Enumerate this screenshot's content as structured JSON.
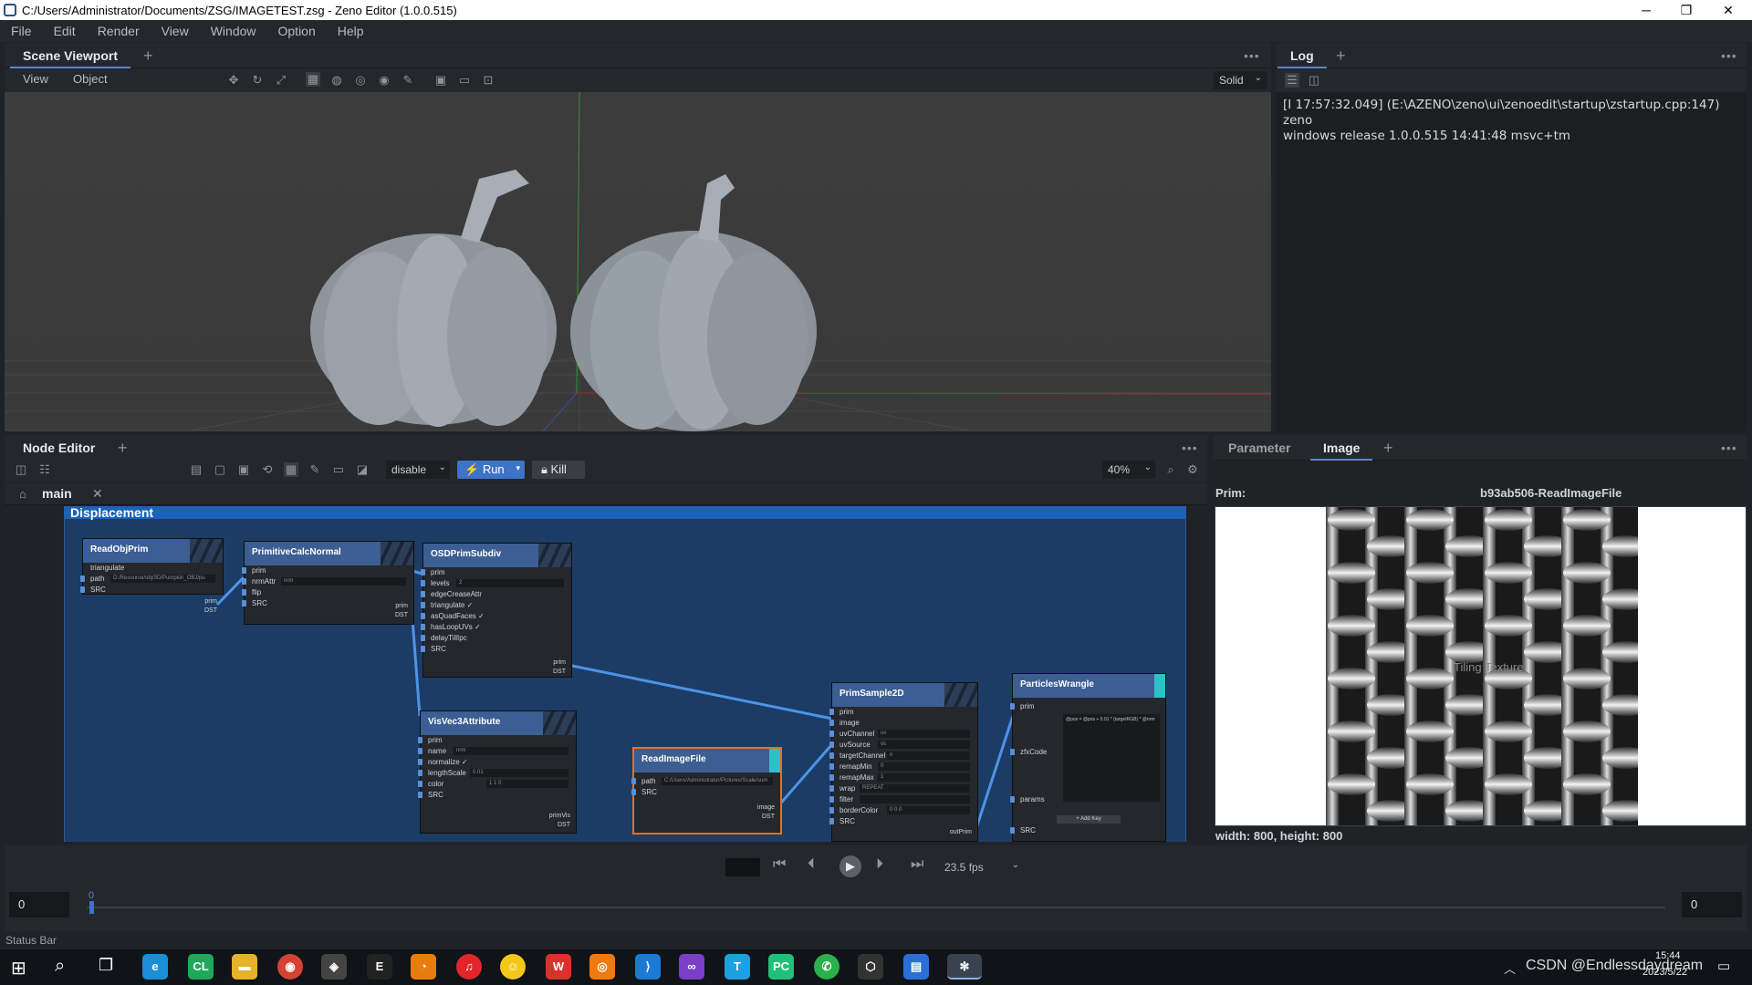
{
  "window": {
    "title": "C:/Users/Administrator/Documents/ZSG/IMAGETEST.zsg - Zeno Editor (1.0.0.515)"
  },
  "menu": [
    "File",
    "Edit",
    "Render",
    "View",
    "Window",
    "Option",
    "Help"
  ],
  "scene_viewport": {
    "tab": "Scene Viewport",
    "toolbar": [
      "View",
      "Object"
    ],
    "render_mode": "Solid"
  },
  "log": {
    "tab": "Log",
    "line1": "[I 17:57:32.049] (E:\\AZENO\\zeno\\ui\\zenoedit\\startup\\zstartup.cpp:147) zeno",
    "line2": "windows release 1.0.0.515 14:41:48 msvc+tm"
  },
  "node_editor": {
    "tab": "Node Editor",
    "mode": "disable",
    "run": "Run",
    "kill": "Kill",
    "zoom": "40%",
    "graph_tab": "main",
    "group_title": "Displacement",
    "nodes": {
      "readobj": {
        "title": "ReadObjPrim",
        "rows": [
          "triangulate",
          "path",
          "SRC"
        ],
        "path_val": "D:/Resource/obj/3D/Pumpkin_OBJ/pu",
        "outs": [
          "prim",
          "DST"
        ]
      },
      "calcnormal": {
        "title": "PrimitiveCalcNormal",
        "rows": [
          "prim",
          "nrmAttr",
          "flip",
          "SRC"
        ],
        "nrm_val": "nrm",
        "outs": [
          "prim",
          "DST"
        ]
      },
      "osd": {
        "title": "OSDPrimSubdiv",
        "rows": [
          "prim",
          "levels",
          "edgeCreaseAttr",
          "triangulate ✓",
          "asQuadFaces ✓",
          "hasLoopUVs ✓",
          "delayTillIpc",
          "SRC"
        ],
        "levels_val": "2",
        "outs": [
          "prim",
          "DST"
        ]
      },
      "visvec": {
        "title": "VisVec3Attribute",
        "rows": [
          "prim",
          "name",
          "normalize ✓",
          "lengthScale",
          "color",
          "SRC"
        ],
        "name_val": "nrm",
        "scale_val": "0.01",
        "color_val": "1       1       0",
        "outs": [
          "primVis",
          "DST"
        ]
      },
      "readimage": {
        "title": "ReadImageFile",
        "rows": [
          "path",
          "SRC"
        ],
        "path_val": "C:/Users/Administrator/Pictures/Scale/sum",
        "outs": [
          "image",
          "DST"
        ]
      },
      "sample": {
        "title": "PrimSample2D",
        "rows": [
          "prim",
          "image",
          "uvChannel",
          "uvSource",
          "targetChannel",
          "remapMin",
          "remapMax",
          "wrap",
          "filter",
          "borderColor",
          "SRC"
        ],
        "vals": [
          "",
          "",
          "uv",
          "vs",
          "n",
          "0",
          "1",
          "REPEAT",
          "",
          "0   0   0",
          ""
        ],
        "outs": [
          "outPrim"
        ]
      },
      "wrangle": {
        "title": "ParticlesWrangle",
        "rows": [
          "prim",
          "zfxCode",
          "params",
          "SRC"
        ],
        "code": "@pos = @pos + 0.01 * (targetRGB) * @nrm",
        "addkey": "+ Add Key"
      }
    }
  },
  "right_panel": {
    "tabs": [
      "Parameter",
      "Image"
    ],
    "prim_label": "Prim:",
    "prim_name": "b93ab506-ReadImageFile",
    "size_text": "width: 800, height: 800",
    "watermark": "Tiling Texture"
  },
  "timeline": {
    "frame_start": "0",
    "frame_end": "0",
    "current": "0",
    "fps": "23.5 fps"
  },
  "status_bar": {
    "text": "Status Bar"
  },
  "taskbar": {
    "time": "15:44",
    "date": "2023/5/22",
    "tray_text": "CSDN @Endlessdaydream"
  }
}
